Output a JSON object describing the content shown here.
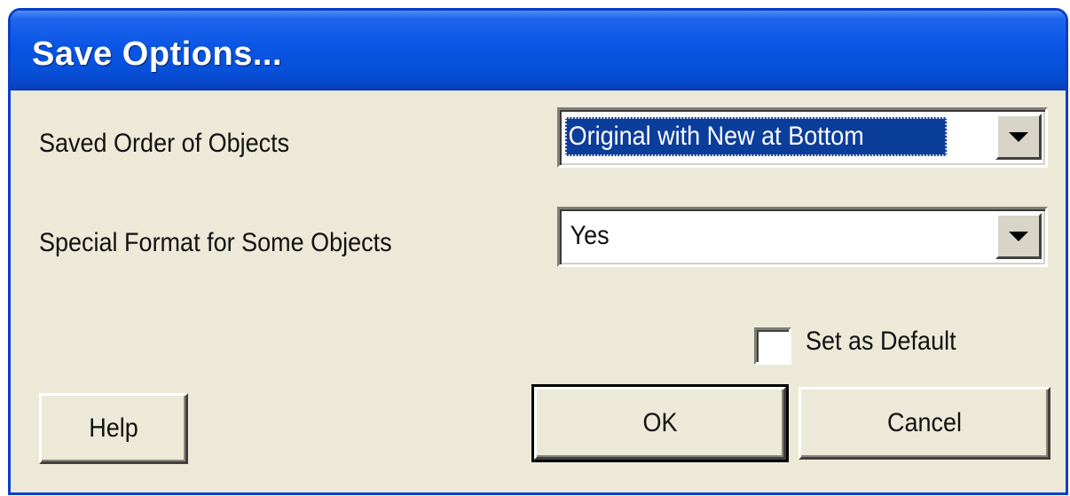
{
  "dialog": {
    "title": "Save Options..."
  },
  "fields": {
    "saved_order": {
      "label": "Saved Order of Objects",
      "value": "Original with New at Bottom"
    },
    "special_format": {
      "label": "Special Format for Some Objects",
      "value": "Yes"
    }
  },
  "set_default": {
    "label": "Set as Default",
    "checked": false
  },
  "buttons": {
    "help": "Help",
    "ok": "OK",
    "cancel": "Cancel"
  },
  "colors": {
    "titlebar": "#0a55e4",
    "dialog_bg": "#ece9d8",
    "selection": "#0b3d9b"
  }
}
